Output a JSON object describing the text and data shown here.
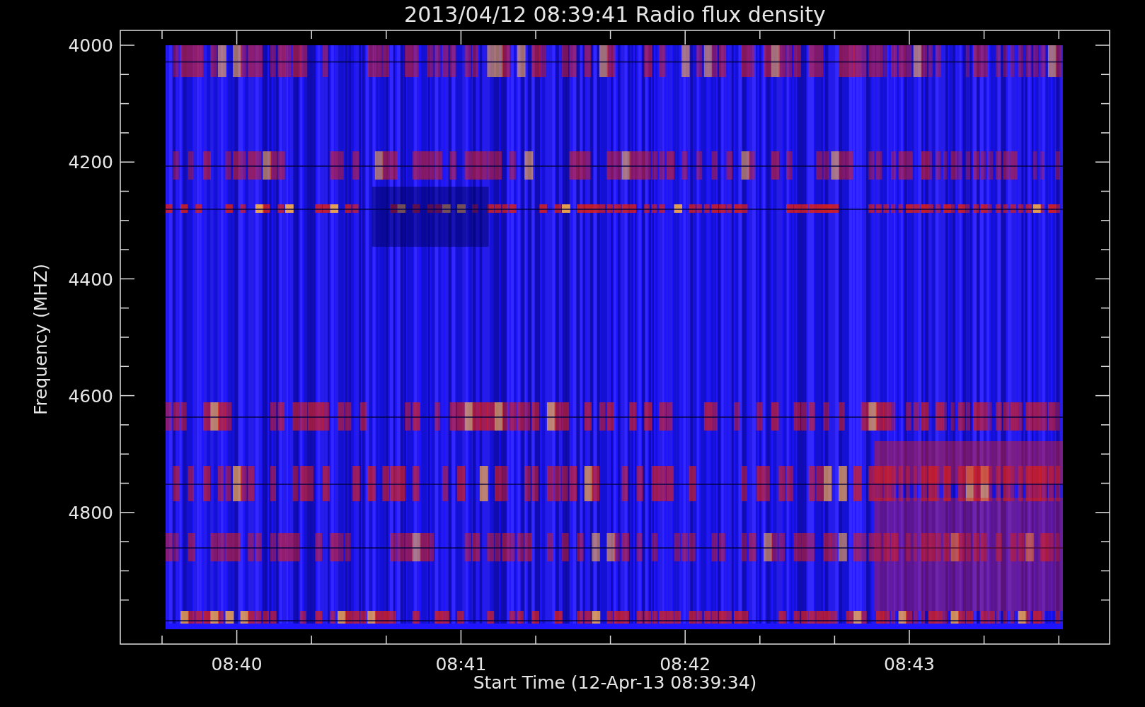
{
  "title": "2013/04/12 08:39:41 Radio flux density",
  "y_axis": {
    "label": "Frequency (MHZ)",
    "ticks": [
      "4000",
      "4200",
      "4400",
      "4600",
      "4800"
    ]
  },
  "x_axis": {
    "label": "Start Time (12-Apr-13 08:39:34)",
    "ticks": [
      "08:40",
      "08:41",
      "08:42",
      "08:43"
    ]
  }
}
